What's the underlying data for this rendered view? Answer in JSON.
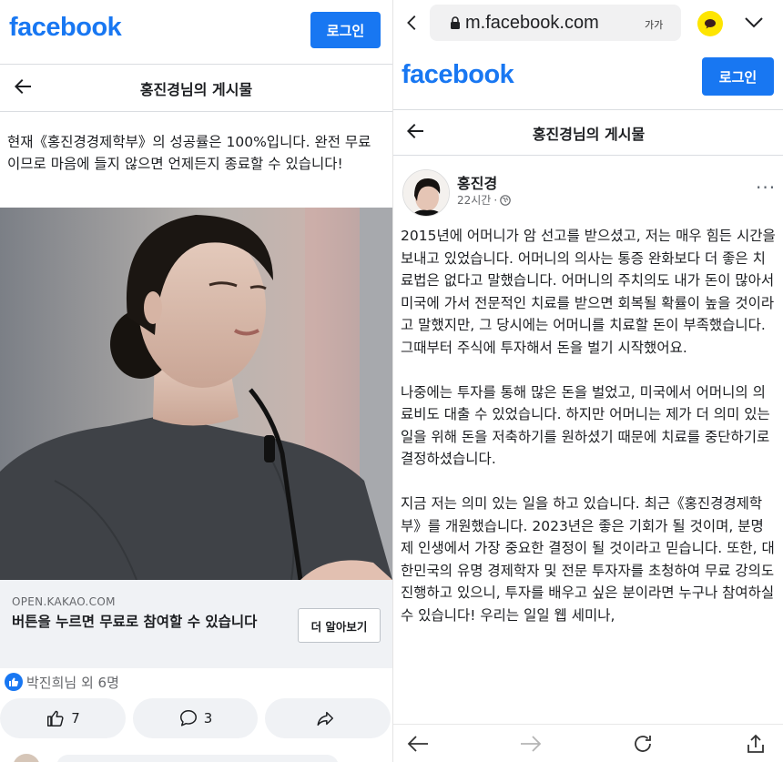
{
  "left": {
    "logo": "facebook",
    "login_label": "로그인",
    "page_title": "홍진경님의 게시물",
    "post_text": "현재《홍진경경제학부》의 성공률은 100%입니다. 완전 무료이므로 마음에 들지 않으면 언제든지 종료할 수 있습니다!",
    "link": {
      "domain": "OPEN.KAKAO.COM",
      "title": "버튼을 누르면 무료로 참여할 수 있습니다",
      "button_label": "더 알아보기"
    },
    "reactions_text": "박진희님 외 6명",
    "actions": {
      "like_count": "7",
      "comment_count": "3"
    }
  },
  "right": {
    "url": "m.facebook.com",
    "text_size_label": "가가",
    "logo": "facebook",
    "login_label": "로그인",
    "page_title": "홍진경님의 게시물",
    "author": "홍진경",
    "time": "22시간",
    "meta_separator": "·",
    "more_icon": "···",
    "paragraphs": [
      "2015년에 어머니가 암 선고를 받으셨고, 저는 매우 힘든 시간을 보내고 있었습니다. 어머니의 의사는 통증 완화보다 더 좋은 치료법은 없다고 말했습니다. 어머니의 주치의도 내가 돈이 많아서 미국에 가서 전문적인 치료를 받으면 회복될 확률이 높을 것이라고 말했지만, 그 당시에는 어머니를 치료할 돈이 부족했습니다. 그때부터 주식에 투자해서 돈을 벌기 시작했어요.",
      "나중에는 투자를 통해 많은 돈을 벌었고, 미국에서 어머니의 의료비도 대출 수 있었습니다. 하지만 어머니는 제가 더 의미 있는 일을 위해 돈을 저축하기를 원하셨기 때문에 치료를 중단하기로 결정하셨습니다.",
      "지금 저는 의미 있는 일을 하고 있습니다. 최근《홍진경경제학부》를 개원했습니다. 2023년은 좋은 기회가 될 것이며, 분명 제 인생에서 가장 중요한 결정이 될 것이라고 믿습니다. 또한, 대한민국의 유명 경제학자 및 전문 투자자를 초청하여 무료 강의도 진행하고 있으니, 투자를 배우고 싶은 분이라면 누구나 참여하실 수 있습니다! 우리는 일일 웹 세미나,"
    ]
  },
  "colors": {
    "facebook_blue": "#1877f2",
    "kakao_yellow": "#fee500"
  }
}
